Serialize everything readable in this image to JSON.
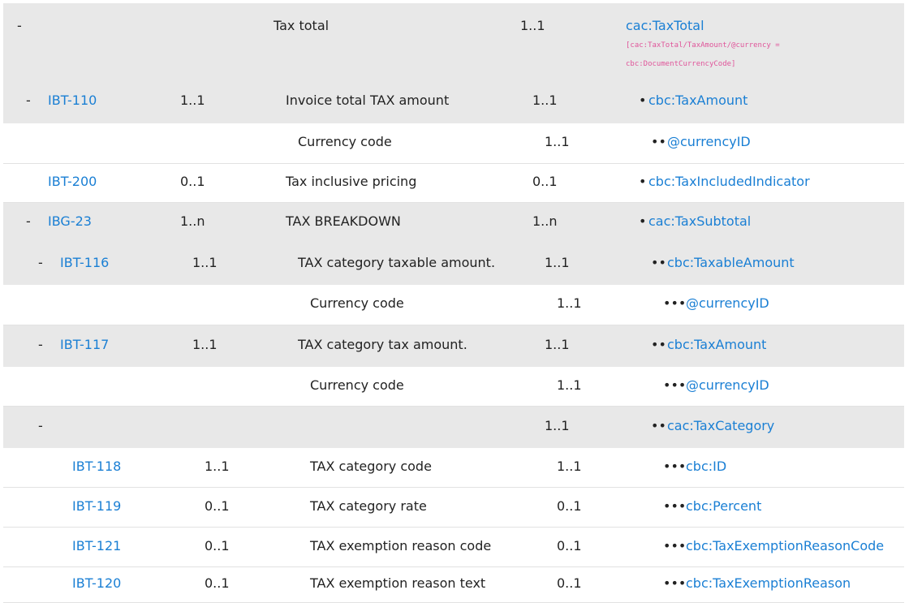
{
  "rows": [
    {
      "toggle": "-",
      "id": "",
      "card": "",
      "name": "Tax total",
      "ubl_card": "1..1",
      "bullets": "",
      "element": "cac:TaxTotal",
      "note1": "[cac:TaxTotal/TaxAmount/@currency =",
      "note2": "cbc:DocumentCurrencyCode]"
    },
    {
      "toggle": "-",
      "id": "IBT-110",
      "card": "1..1",
      "name": "Invoice total TAX amount",
      "ubl_card": "1..1",
      "bullets": "•",
      "element": "cbc:TaxAmount"
    },
    {
      "toggle": "",
      "id": "",
      "card": "",
      "name": "Currency code",
      "ubl_card": "1..1",
      "bullets": "••",
      "element": "@currencyID"
    },
    {
      "toggle": "",
      "id": "IBT-200",
      "card": "0..1",
      "name": "Tax inclusive pricing",
      "ubl_card": "0..1",
      "bullets": "•",
      "element": "cbc:TaxIncludedIndicator"
    },
    {
      "toggle": "-",
      "id": "IBG-23",
      "card": "1..n",
      "name": "TAX BREAKDOWN",
      "ubl_card": "1..n",
      "bullets": "•",
      "element": "cac:TaxSubtotal"
    },
    {
      "toggle": "-",
      "id": "IBT-116",
      "card": "1..1",
      "name": "TAX category taxable amount.",
      "ubl_card": "1..1",
      "bullets": "••",
      "element": "cbc:TaxableAmount"
    },
    {
      "toggle": "",
      "id": "",
      "card": "",
      "name": "Currency code",
      "ubl_card": "1..1",
      "bullets": "•••",
      "element": "@currencyID"
    },
    {
      "toggle": "-",
      "id": "IBT-117",
      "card": "1..1",
      "name": "TAX category tax amount.",
      "ubl_card": "1..1",
      "bullets": "••",
      "element": "cbc:TaxAmount"
    },
    {
      "toggle": "",
      "id": "",
      "card": "",
      "name": "Currency code",
      "ubl_card": "1..1",
      "bullets": "•••",
      "element": "@currencyID"
    },
    {
      "toggle": "-",
      "id": "",
      "card": "",
      "name": "",
      "ubl_card": "1..1",
      "bullets": "••",
      "element": "cac:TaxCategory"
    },
    {
      "toggle": "",
      "id": "IBT-118",
      "card": "1..1",
      "name": "TAX category code",
      "ubl_card": "1..1",
      "bullets": "•••",
      "element": "cbc:ID"
    },
    {
      "toggle": "",
      "id": "IBT-119",
      "card": "0..1",
      "name": "TAX category rate",
      "ubl_card": "0..1",
      "bullets": "•••",
      "element": "cbc:Percent"
    },
    {
      "toggle": "",
      "id": "IBT-121",
      "card": "0..1",
      "name": "TAX exemption reason code",
      "ubl_card": "0..1",
      "bullets": "•••",
      "element": "cbc:TaxExemptionReasonCode"
    },
    {
      "toggle": "",
      "id": "IBT-120",
      "card": "0..1",
      "name": "TAX exemption reason text",
      "ubl_card": "0..1",
      "bullets": "•••",
      "element": "cbc:TaxExemptionReason"
    }
  ],
  "colors": {
    "row_gray": "#e8e8e8",
    "link": "#1a7fd4",
    "note": "#e0559a"
  }
}
